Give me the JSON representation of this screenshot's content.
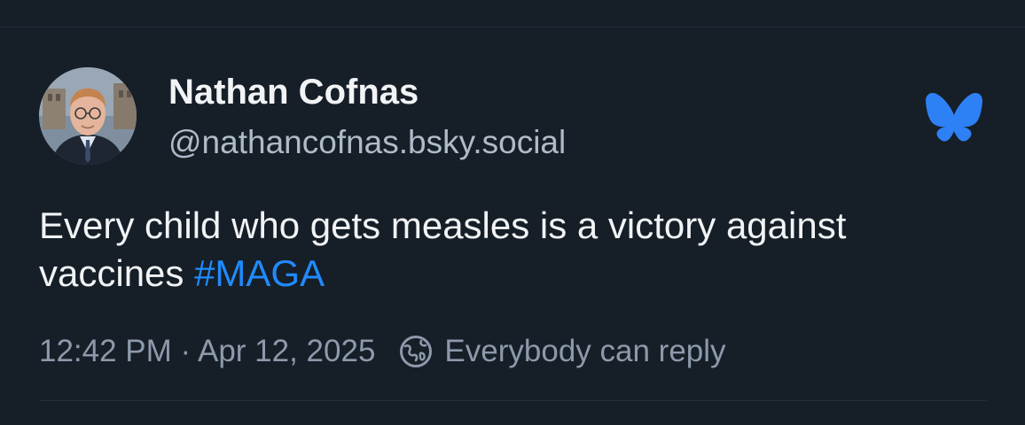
{
  "post": {
    "author_name": "Nathan Cofnas",
    "author_handle": "@nathancofnas.bsky.social",
    "text": "Every child who gets measles is a victory against vaccines ",
    "hashtag": "#MAGA",
    "timestamp": "12:42 PM · Apr 12, 2025",
    "reply_setting": "Everybody can reply"
  },
  "icons": {
    "brand": "bluesky-butterfly-icon",
    "reply": "globe-icon"
  },
  "colors": {
    "background": "#161e27",
    "text": "#f1f3f5",
    "secondary_text": "#aebbc9",
    "meta_text": "#8c9aab",
    "hashtag": "#208bfe",
    "brand": "#2e80f5"
  }
}
